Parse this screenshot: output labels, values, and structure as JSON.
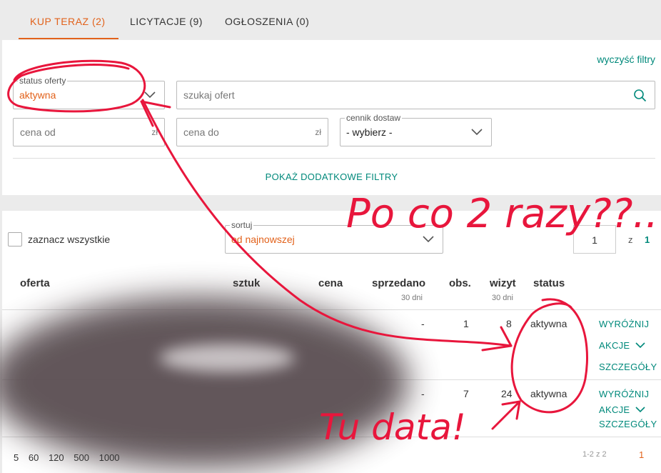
{
  "tabs": [
    {
      "label": "KUP TERAZ (2)"
    },
    {
      "label": "LICYTACJE (9)"
    },
    {
      "label": "OGŁOSZENIA (0)"
    }
  ],
  "filters": {
    "clear_label": "wyczyść filtry",
    "status": {
      "legend": "status oferty",
      "value": "aktywna"
    },
    "search": {
      "placeholder": "szukaj ofert"
    },
    "price_from": {
      "placeholder": "cena od",
      "unit": "zł"
    },
    "price_to": {
      "placeholder": "cena do",
      "unit": "zł"
    },
    "shipping": {
      "legend": "cennik dostaw",
      "value": "- wybierz -"
    },
    "more_filters_label": "POKAŻ DODATKOWE FILTRY"
  },
  "list": {
    "select_all_label": "zaznacz wszystkie",
    "sort": {
      "legend": "sortuj",
      "value": "od najnowszej"
    },
    "pager": {
      "current": "1",
      "of_label": "z",
      "total": "1"
    },
    "columns": {
      "offer": "oferta",
      "qty": "sztuk",
      "price": "cena",
      "sold": "sprzedano",
      "sold_sub": "30 dni",
      "obs": "obs.",
      "visits": "wizyt",
      "visits_sub": "30 dni",
      "status": "status"
    },
    "rows": [
      {
        "sold": "-",
        "obs": "1",
        "visits": "8",
        "status": "aktywna",
        "actions": {
          "highlight": "WYRÓŻNIJ",
          "actions": "AKCJE",
          "details": "SZCZEGÓŁY"
        }
      },
      {
        "sold": "-",
        "obs": "7",
        "visits": "24",
        "status": "aktywna",
        "actions": {
          "highlight": "WYRÓŻNIJ",
          "actions": "AKCJE",
          "details": "SZCZEGÓŁY"
        }
      }
    ],
    "per_page": [
      "5",
      "60",
      "120",
      "500",
      "1000"
    ],
    "range_label": "1-2 z 2",
    "page_link": "1"
  },
  "annotations": {
    "top_text": "Po co 2 razy??..",
    "bottom_text": "Tu data!"
  },
  "colors": {
    "accent_orange": "#e2621b",
    "accent_teal": "#00897b",
    "annotation_red": "#e8163c"
  }
}
